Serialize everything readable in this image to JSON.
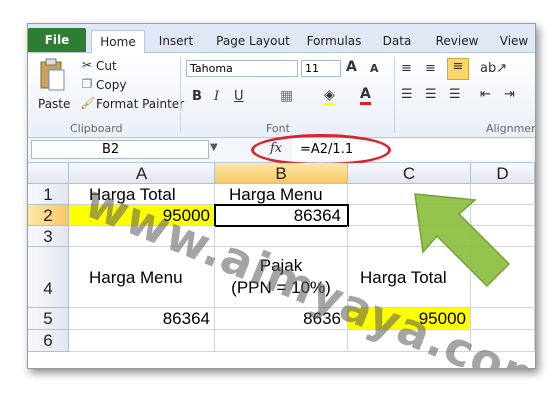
{
  "tabs": [
    "File",
    "Home",
    "Insert",
    "Page Layout",
    "Formulas",
    "Data",
    "Review",
    "View"
  ],
  "clipboard": {
    "paste": "Paste",
    "cut": "Cut",
    "copy": "Copy",
    "format_painter": "Format Painter",
    "label": "Clipboard"
  },
  "font": {
    "name": "Tahoma",
    "size": "11",
    "label": "Font",
    "bold": "B",
    "italic": "I",
    "underline": "U",
    "grow": "A",
    "shrink": "A"
  },
  "alignment": {
    "label": "Alignment"
  },
  "formula_bar": {
    "name_box": "B2",
    "fx": "fx",
    "formula": "=A2/1.1"
  },
  "columns": [
    "A",
    "B",
    "C",
    "D"
  ],
  "rows": [
    "1",
    "2",
    "3",
    "4",
    "5",
    "6"
  ],
  "cells": {
    "a1": "Harga Total",
    "b1": "Harga Menu",
    "a2": "95000",
    "b2": "86364",
    "a4": "Harga Menu",
    "b4_line1": "Pajak",
    "b4_line2": "(PPN = 10%)",
    "c4": "Harga Total",
    "a5": "86364",
    "b5": "8636",
    "c5": "95000"
  },
  "watermark": "www.aimyaya.com",
  "colors": {
    "file_tab": "#2e7d32",
    "highlight": "#ffff00",
    "circle": "#d6262b",
    "arrow": "#8bbf3f"
  }
}
